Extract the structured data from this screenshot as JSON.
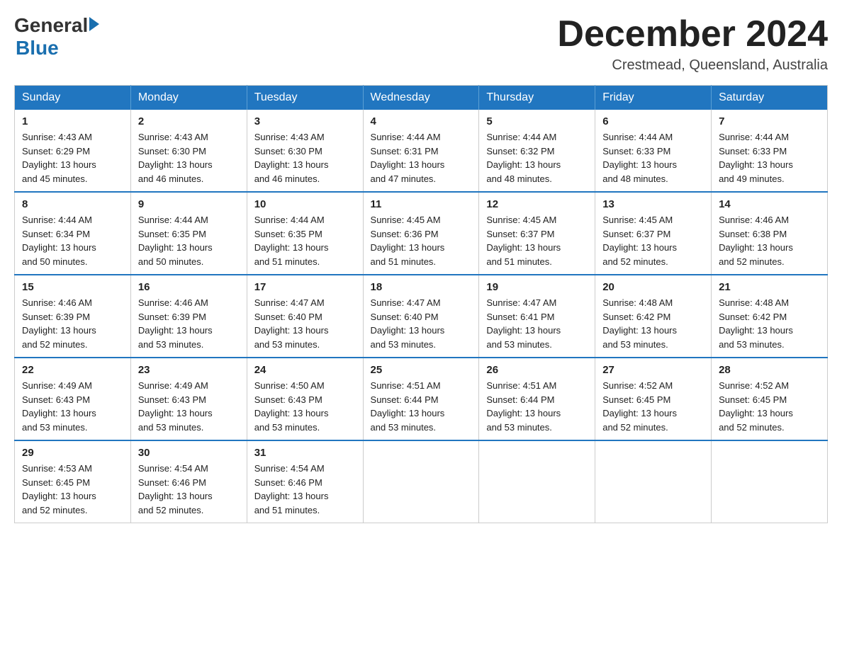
{
  "logo": {
    "general": "General",
    "arrow": "",
    "blue": "Blue"
  },
  "title": {
    "month": "December 2024",
    "location": "Crestmead, Queensland, Australia"
  },
  "days_of_week": [
    "Sunday",
    "Monday",
    "Tuesday",
    "Wednesday",
    "Thursday",
    "Friday",
    "Saturday"
  ],
  "weeks": [
    [
      {
        "day": "1",
        "sunrise": "4:43 AM",
        "sunset": "6:29 PM",
        "daylight": "13 hours and 45 minutes."
      },
      {
        "day": "2",
        "sunrise": "4:43 AM",
        "sunset": "6:30 PM",
        "daylight": "13 hours and 46 minutes."
      },
      {
        "day": "3",
        "sunrise": "4:43 AM",
        "sunset": "6:30 PM",
        "daylight": "13 hours and 46 minutes."
      },
      {
        "day": "4",
        "sunrise": "4:44 AM",
        "sunset": "6:31 PM",
        "daylight": "13 hours and 47 minutes."
      },
      {
        "day": "5",
        "sunrise": "4:44 AM",
        "sunset": "6:32 PM",
        "daylight": "13 hours and 48 minutes."
      },
      {
        "day": "6",
        "sunrise": "4:44 AM",
        "sunset": "6:33 PM",
        "daylight": "13 hours and 48 minutes."
      },
      {
        "day": "7",
        "sunrise": "4:44 AM",
        "sunset": "6:33 PM",
        "daylight": "13 hours and 49 minutes."
      }
    ],
    [
      {
        "day": "8",
        "sunrise": "4:44 AM",
        "sunset": "6:34 PM",
        "daylight": "13 hours and 50 minutes."
      },
      {
        "day": "9",
        "sunrise": "4:44 AM",
        "sunset": "6:35 PM",
        "daylight": "13 hours and 50 minutes."
      },
      {
        "day": "10",
        "sunrise": "4:44 AM",
        "sunset": "6:35 PM",
        "daylight": "13 hours and 51 minutes."
      },
      {
        "day": "11",
        "sunrise": "4:45 AM",
        "sunset": "6:36 PM",
        "daylight": "13 hours and 51 minutes."
      },
      {
        "day": "12",
        "sunrise": "4:45 AM",
        "sunset": "6:37 PM",
        "daylight": "13 hours and 51 minutes."
      },
      {
        "day": "13",
        "sunrise": "4:45 AM",
        "sunset": "6:37 PM",
        "daylight": "13 hours and 52 minutes."
      },
      {
        "day": "14",
        "sunrise": "4:46 AM",
        "sunset": "6:38 PM",
        "daylight": "13 hours and 52 minutes."
      }
    ],
    [
      {
        "day": "15",
        "sunrise": "4:46 AM",
        "sunset": "6:39 PM",
        "daylight": "13 hours and 52 minutes."
      },
      {
        "day": "16",
        "sunrise": "4:46 AM",
        "sunset": "6:39 PM",
        "daylight": "13 hours and 53 minutes."
      },
      {
        "day": "17",
        "sunrise": "4:47 AM",
        "sunset": "6:40 PM",
        "daylight": "13 hours and 53 minutes."
      },
      {
        "day": "18",
        "sunrise": "4:47 AM",
        "sunset": "6:40 PM",
        "daylight": "13 hours and 53 minutes."
      },
      {
        "day": "19",
        "sunrise": "4:47 AM",
        "sunset": "6:41 PM",
        "daylight": "13 hours and 53 minutes."
      },
      {
        "day": "20",
        "sunrise": "4:48 AM",
        "sunset": "6:42 PM",
        "daylight": "13 hours and 53 minutes."
      },
      {
        "day": "21",
        "sunrise": "4:48 AM",
        "sunset": "6:42 PM",
        "daylight": "13 hours and 53 minutes."
      }
    ],
    [
      {
        "day": "22",
        "sunrise": "4:49 AM",
        "sunset": "6:43 PM",
        "daylight": "13 hours and 53 minutes."
      },
      {
        "day": "23",
        "sunrise": "4:49 AM",
        "sunset": "6:43 PM",
        "daylight": "13 hours and 53 minutes."
      },
      {
        "day": "24",
        "sunrise": "4:50 AM",
        "sunset": "6:43 PM",
        "daylight": "13 hours and 53 minutes."
      },
      {
        "day": "25",
        "sunrise": "4:51 AM",
        "sunset": "6:44 PM",
        "daylight": "13 hours and 53 minutes."
      },
      {
        "day": "26",
        "sunrise": "4:51 AM",
        "sunset": "6:44 PM",
        "daylight": "13 hours and 53 minutes."
      },
      {
        "day": "27",
        "sunrise": "4:52 AM",
        "sunset": "6:45 PM",
        "daylight": "13 hours and 52 minutes."
      },
      {
        "day": "28",
        "sunrise": "4:52 AM",
        "sunset": "6:45 PM",
        "daylight": "13 hours and 52 minutes."
      }
    ],
    [
      {
        "day": "29",
        "sunrise": "4:53 AM",
        "sunset": "6:45 PM",
        "daylight": "13 hours and 52 minutes."
      },
      {
        "day": "30",
        "sunrise": "4:54 AM",
        "sunset": "6:46 PM",
        "daylight": "13 hours and 52 minutes."
      },
      {
        "day": "31",
        "sunrise": "4:54 AM",
        "sunset": "6:46 PM",
        "daylight": "13 hours and 51 minutes."
      },
      null,
      null,
      null,
      null
    ]
  ],
  "labels": {
    "sunrise": "Sunrise:",
    "sunset": "Sunset:",
    "daylight": "Daylight:"
  }
}
